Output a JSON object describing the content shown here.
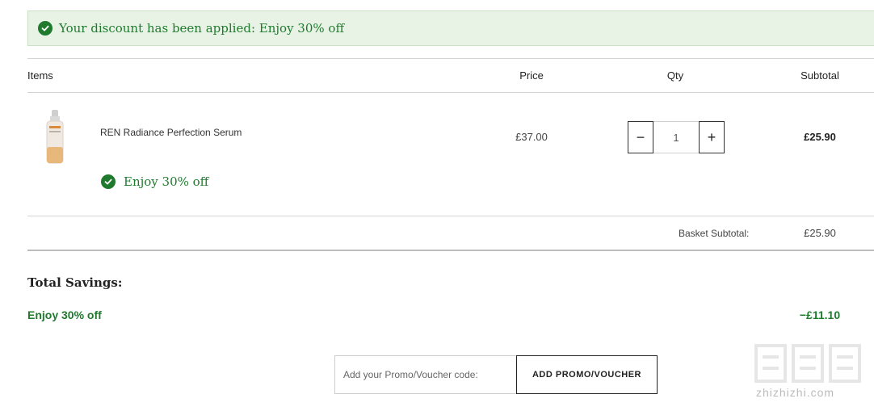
{
  "banner": {
    "message": "Your discount has been applied: Enjoy 30% off",
    "icon": "check-circle-icon"
  },
  "table": {
    "headers": {
      "items": "Items",
      "price": "Price",
      "qty": "Qty",
      "subtotal": "Subtotal"
    },
    "rows": [
      {
        "name": "REN Radiance Perfection Serum",
        "price": "£37.00",
        "qty": "1",
        "subtotal": "£25.90",
        "offer": "Enjoy 30% off",
        "decrease_label": "−",
        "increase_label": "+"
      }
    ]
  },
  "basket": {
    "label": "Basket Subtotal:",
    "value": "£25.90"
  },
  "savings": {
    "title": "Total Savings:",
    "name": "Enjoy 30% off",
    "amount": "−£11.10"
  },
  "promo": {
    "placeholder": "Add your Promo/Voucher code:",
    "button_label": "ADD PROMO/VOUCHER"
  },
  "watermark": {
    "text": "zhizhizhi.com"
  },
  "colors": {
    "success": "#1f7a2e",
    "banner_bg": "#e8f3e6"
  }
}
